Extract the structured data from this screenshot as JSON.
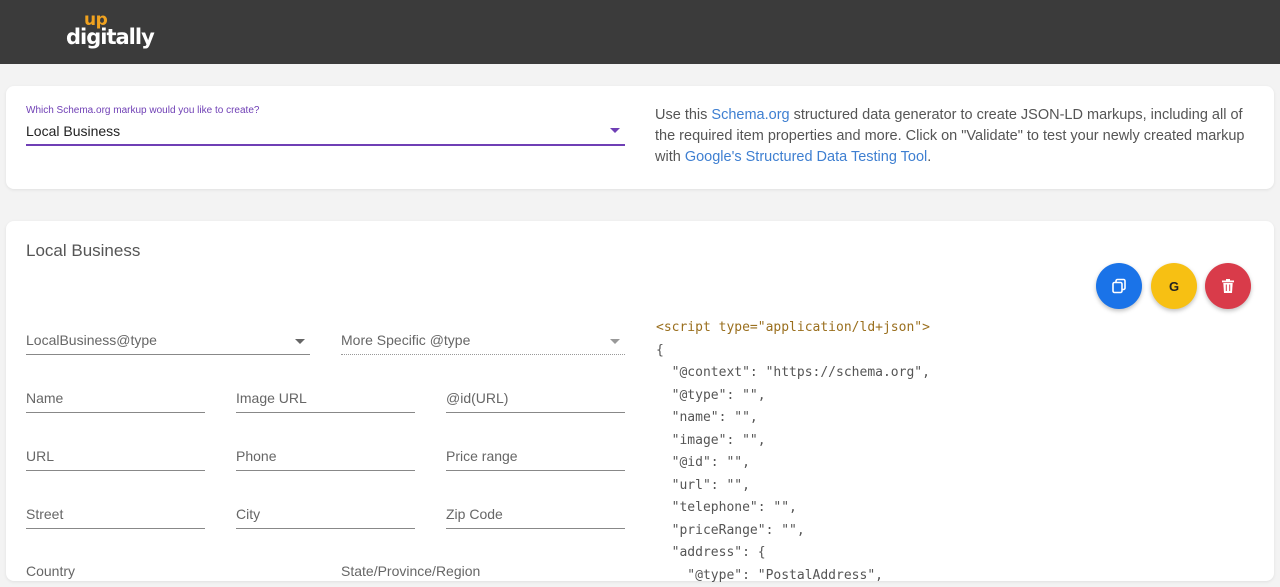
{
  "header": {
    "logo_top": "up",
    "logo_bottom": "digitally"
  },
  "selector": {
    "label": "Which Schema.org markup would you like to create?",
    "value": "Local Business"
  },
  "intro": {
    "part1": "Use this ",
    "link1": "Schema.org",
    "part2": " structured data generator to create JSON-LD markups, including all of the required item properties and more. Click on \"Validate\" to test your newly created markup with ",
    "link2": "Google's Structured Data Testing Tool",
    "part3": "."
  },
  "form": {
    "title": "Local Business",
    "type_select": "LocalBusiness@type",
    "specific_type_select": "More Specific @type",
    "fields": {
      "name": "Name",
      "image_url": "Image URL",
      "id_url": "@id(URL)",
      "url": "URL",
      "phone": "Phone",
      "price_range": "Price range",
      "street": "Street",
      "city": "City",
      "zip": "Zip Code",
      "country": "Country",
      "state": "State/Province/Region"
    }
  },
  "actions": {
    "copy_icon": "copy-icon",
    "google_label": "G",
    "delete_icon": "trash-icon"
  },
  "code": {
    "open_tag": "<script type=\"application/ld+json\">",
    "lines": [
      "{",
      "  \"@context\": \"https://schema.org\",",
      "  \"@type\": \"\",",
      "  \"name\": \"\",",
      "  \"image\": \"\",",
      "  \"@id\": \"\",",
      "  \"url\": \"\",",
      "  \"telephone\": \"\",",
      "  \"priceRange\": \"\",",
      "  \"address\": {",
      "    \"@type\": \"PostalAddress\","
    ]
  },
  "colors": {
    "accent_purple": "#6f3fb5",
    "copy_blue": "#1a73e8",
    "google_yellow": "#f7c013",
    "delete_red": "#d93b4a"
  }
}
